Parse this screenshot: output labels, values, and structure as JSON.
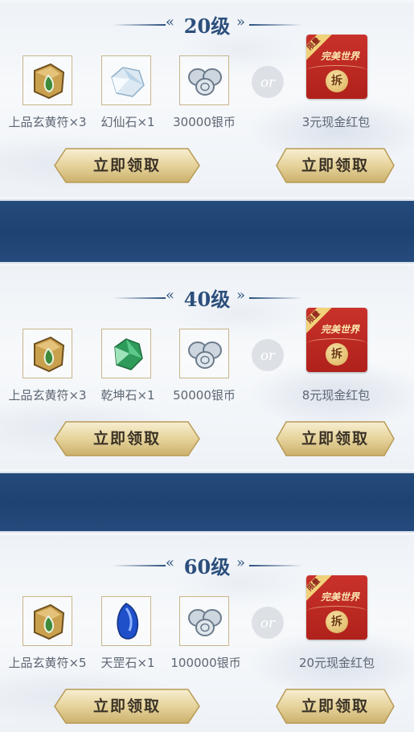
{
  "accent_blue": "#2c4f7c",
  "button_gold": "#e8d7a2",
  "tiers": [
    {
      "level": "20级",
      "items": [
        {
          "icon": "talisman-icon",
          "label": "上品玄黄符×3"
        },
        {
          "icon": "crystal-icon",
          "label": "幻仙石×1"
        },
        {
          "icon": "silver-coins-icon",
          "label": "30000银币"
        }
      ],
      "or_text": "or",
      "redpacket": {
        "tag": "限量",
        "brand": "完美世界",
        "seal": "拆",
        "label": "3元现金红包"
      },
      "claim_left": "立即领取",
      "claim_right": "立即领取"
    },
    {
      "level": "40级",
      "items": [
        {
          "icon": "talisman-icon",
          "label": "上品玄黄符×3"
        },
        {
          "icon": "green-gem-icon",
          "label": "乾坤石×1"
        },
        {
          "icon": "silver-coins-icon",
          "label": "50000银币"
        }
      ],
      "or_text": "or",
      "redpacket": {
        "tag": "限量",
        "brand": "完美世界",
        "seal": "拆",
        "label": "8元现金红包"
      },
      "claim_left": "立即领取",
      "claim_right": "立即领取"
    },
    {
      "level": "60级",
      "items": [
        {
          "icon": "talisman-icon",
          "label": "上品玄黄符×5"
        },
        {
          "icon": "blue-gem-icon",
          "label": "天罡石×1"
        },
        {
          "icon": "silver-coins-icon",
          "label": "100000银币"
        }
      ],
      "or_text": "or",
      "redpacket": {
        "tag": "限量",
        "brand": "完美世界",
        "seal": "拆",
        "label": "20元现金红包"
      },
      "claim_left": "立即领取",
      "claim_right": "立即领取"
    }
  ]
}
